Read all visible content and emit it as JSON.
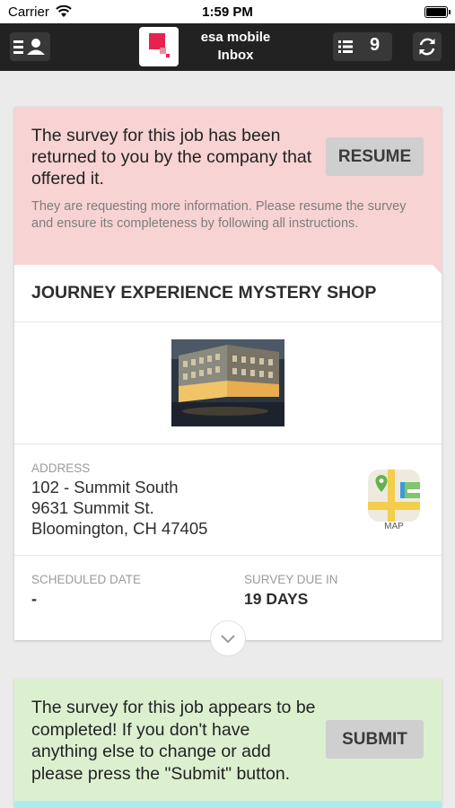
{
  "status_bar": {
    "carrier": "Carrier",
    "time": "1:59 PM"
  },
  "nav": {
    "app_name": "esa mobile",
    "section": "Inbox",
    "inbox_count": "9"
  },
  "returned_alert": {
    "message": "The survey for this job has been returned to you by the company that offered it.",
    "details": "They are requesting more information. Please resume the survey and ensure its completeness by following all instructions.",
    "resume_label": "RESUME"
  },
  "job": {
    "title": "JOURNEY EXPERIENCE MYSTERY SHOP",
    "address_label": "ADDRESS",
    "address_lines": [
      "102 - Summit South",
      "9631 Summit St.",
      "Bloomington, CH 47405"
    ],
    "map_label": "MAP",
    "scheduled_label": "SCHEDULED DATE",
    "scheduled_value": "-",
    "due_label": "SURVEY DUE IN",
    "due_value": "19 DAYS"
  },
  "complete_alert": {
    "message": "The survey for this job appears to be completed! If you don't have anything else to change or add please press the \"Submit\" button.",
    "submit_label": "SUBMIT"
  },
  "colors": {
    "returned_bg": "#f8d3d3",
    "complete_bg": "#dcf0d0",
    "nav_bg": "#222222",
    "strip": "#a8ecf0"
  }
}
